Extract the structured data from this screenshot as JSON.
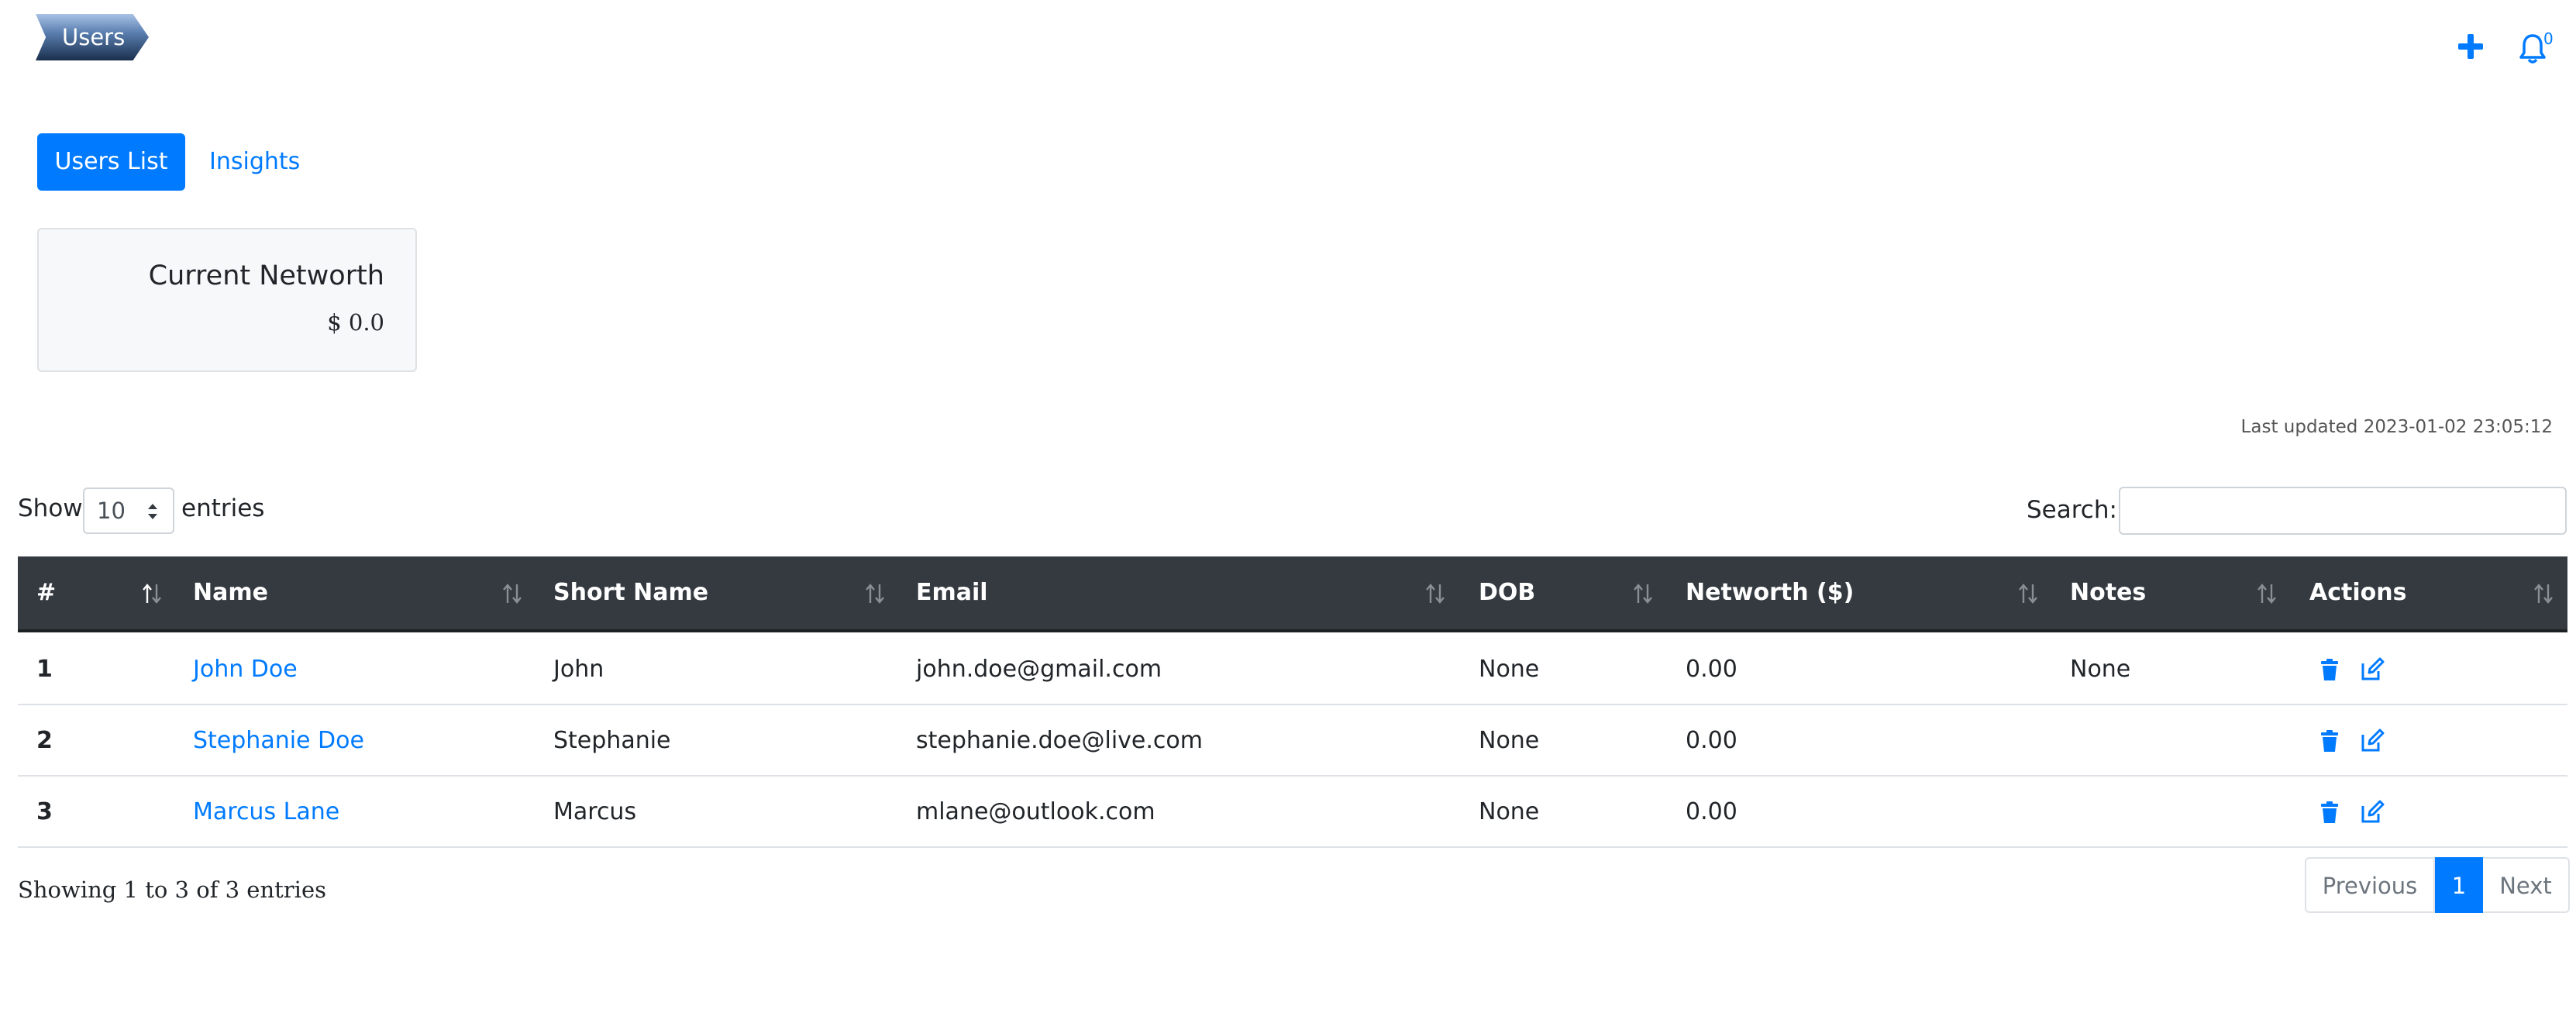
{
  "breadcrumb": {
    "label": "Users"
  },
  "topbar": {
    "add_icon": "plus-icon",
    "bell_icon": "bell-icon",
    "notification_count": "0"
  },
  "tabs": [
    {
      "label": "Users List",
      "active": true
    },
    {
      "label": "Insights",
      "active": false
    }
  ],
  "networth_card": {
    "title": "Current Networth",
    "value": "$ 0.0"
  },
  "last_updated": "Last updated 2023-01-02 23:05:12",
  "table_controls": {
    "show_label": "Show",
    "page_length": "10",
    "entries_label": "entries",
    "search_label": "Search:",
    "search_value": ""
  },
  "table": {
    "columns": [
      "#",
      "Name",
      "Short Name",
      "Email",
      "DOB",
      "Networth ($)",
      "Notes",
      "Actions"
    ],
    "rows": [
      {
        "num": "1",
        "name": "John Doe",
        "short": "John",
        "email": "john.doe@gmail.com",
        "dob": "None",
        "networth": "0.00",
        "notes": "None"
      },
      {
        "num": "2",
        "name": "Stephanie Doe",
        "short": "Stephanie",
        "email": "stephanie.doe@live.com",
        "dob": "None",
        "networth": "0.00",
        "notes": ""
      },
      {
        "num": "3",
        "name": "Marcus Lane",
        "short": "Marcus",
        "email": "mlane@outlook.com",
        "dob": "None",
        "networth": "0.00",
        "notes": ""
      }
    ]
  },
  "footer": {
    "info": "Showing 1 to 3 of 3 entries",
    "pagination": {
      "previous": "Previous",
      "current": "1",
      "next": "Next"
    }
  },
  "colors": {
    "accent": "#007bff",
    "header_bg": "#343a40",
    "card_bg": "#f7f8fa"
  }
}
